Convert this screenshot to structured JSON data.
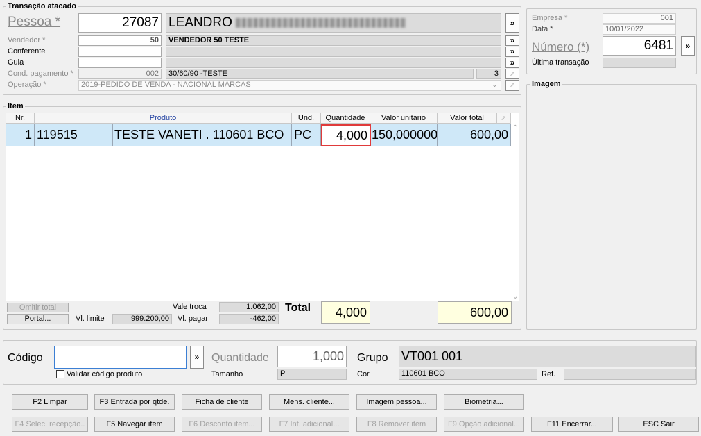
{
  "transacao": {
    "group_title": "Transação atacado",
    "pessoa": {
      "label": "Pessoa *",
      "code": "27087",
      "name": "LEANDRO"
    },
    "vendedor": {
      "label": "Vendedor *",
      "code": "50",
      "name": "VENDEDOR 50 TESTE"
    },
    "conferente": {
      "label": "Conferente",
      "code": "",
      "name": ""
    },
    "guia": {
      "label": "Guia",
      "code": "",
      "name": ""
    },
    "cond_pagamento": {
      "label": "Cond. pagamento *",
      "code": "002",
      "name": "30/60/90 -TESTE",
      "parcelas": "3"
    },
    "operacao": {
      "label": "Operação *",
      "value": "2019-PEDIDO DE VENDA - NACIONAL MARCAS"
    },
    "more_glyph": "»"
  },
  "empresa_panel": {
    "empresa_label": "Empresa *",
    "empresa_value": "001",
    "data_label": "Data *",
    "data_value": "10/01/2022",
    "numero_label": "Número (*)",
    "numero_value": "6481",
    "ultima_label": "Última transação",
    "ultima_value": ""
  },
  "imagem": {
    "title": "Imagem"
  },
  "item": {
    "group_title": "Item",
    "columns": [
      "Nr.",
      "Produto",
      "Und.",
      "Quantidade",
      "Valor unitário",
      "Valor total"
    ],
    "rows": [
      {
        "nr": "1",
        "codigo": "119515",
        "produto": "TESTE VANETI . 110601 BCO",
        "und": "PC",
        "quantidade": "4,000",
        "valor_unitario": "150,000000",
        "valor_total": "600,00"
      }
    ]
  },
  "footer_totals": {
    "omitir_total": "Omitir total",
    "portal": "Portal...",
    "vl_limite_label": "Vl. limite",
    "vl_limite": "999.200,00",
    "vale_troca_label": "Vale troca",
    "vale_troca": "1.062,00",
    "vl_pagar_label": "Vl. pagar",
    "vl_pagar": "-462,00",
    "total_label": "Total",
    "total_quantidade": "4,000",
    "total_valor": "600,00"
  },
  "entrada": {
    "codigo_label": "Código",
    "codigo_value": "",
    "validar_label": "Validar código produto",
    "quantidade_label": "Quantidade",
    "quantidade_value": "1,000",
    "tamanho_label": "Tamanho",
    "tamanho_value": "P",
    "grupo_label": "Grupo",
    "grupo_value": "VT001 001",
    "cor_label": "Cor",
    "cor_value": "110601 BCO",
    "ref_label": "Ref.",
    "ref_value": ""
  },
  "buttons_row1": [
    "F2 Limpar",
    "F3 Entrada por qtde.",
    "Ficha de cliente",
    "Mens. cliente...",
    "Imagem pessoa...",
    "Biometria..."
  ],
  "buttons_row2": [
    "F4 Selec. recepção..",
    "F5 Navegar item",
    "F6 Desconto item...",
    "F7 Inf. adicional...",
    "F8 Remover item",
    "F9 Opção adicional...",
    "F11 Encerrar...",
    "ESC Sair"
  ],
  "colors": {
    "selected_row": "#cfe8f8",
    "focus_border": "#e03a3a",
    "total_bg": "#ffffe0"
  }
}
